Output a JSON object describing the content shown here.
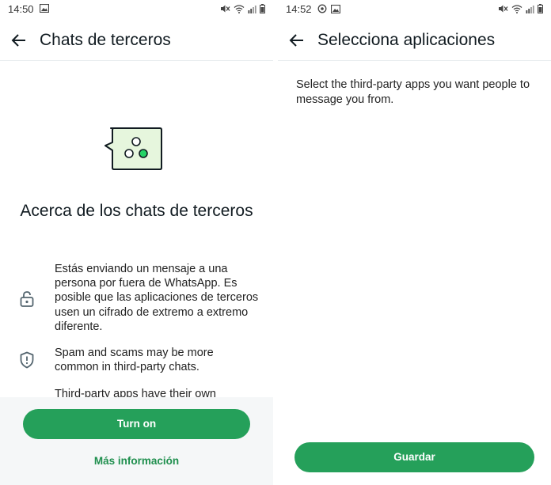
{
  "left": {
    "status": {
      "time": "14:50"
    },
    "appbar": {
      "title": "Chats de terceros"
    },
    "heading": "Acerca de los chats de terceros",
    "info": [
      {
        "icon": "lock-icon",
        "text": "Estás enviando un mensaje a una persona por fuera de WhatsApp. Es posible que las aplicaciones de terceros usen un cifrado de extremo a extremo diferente."
      },
      {
        "icon": "shield-alert-icon",
        "text": "Spam and scams may be more common in third-party chats."
      },
      {
        "icon": "",
        "text": "Third-party apps have their own"
      }
    ],
    "actions": {
      "primary": "Turn on",
      "link": "Más información"
    }
  },
  "right": {
    "status": {
      "time": "14:52"
    },
    "appbar": {
      "title": "Selecciona aplicaciones"
    },
    "description": "Select the third-party apps you want people to message you from.",
    "actions": {
      "primary": "Guardar"
    }
  },
  "colors": {
    "accent": "#25a05a",
    "link": "#1f8f4e",
    "hero_fill": "#e6f6dd",
    "hero_dot": "#25d366"
  }
}
